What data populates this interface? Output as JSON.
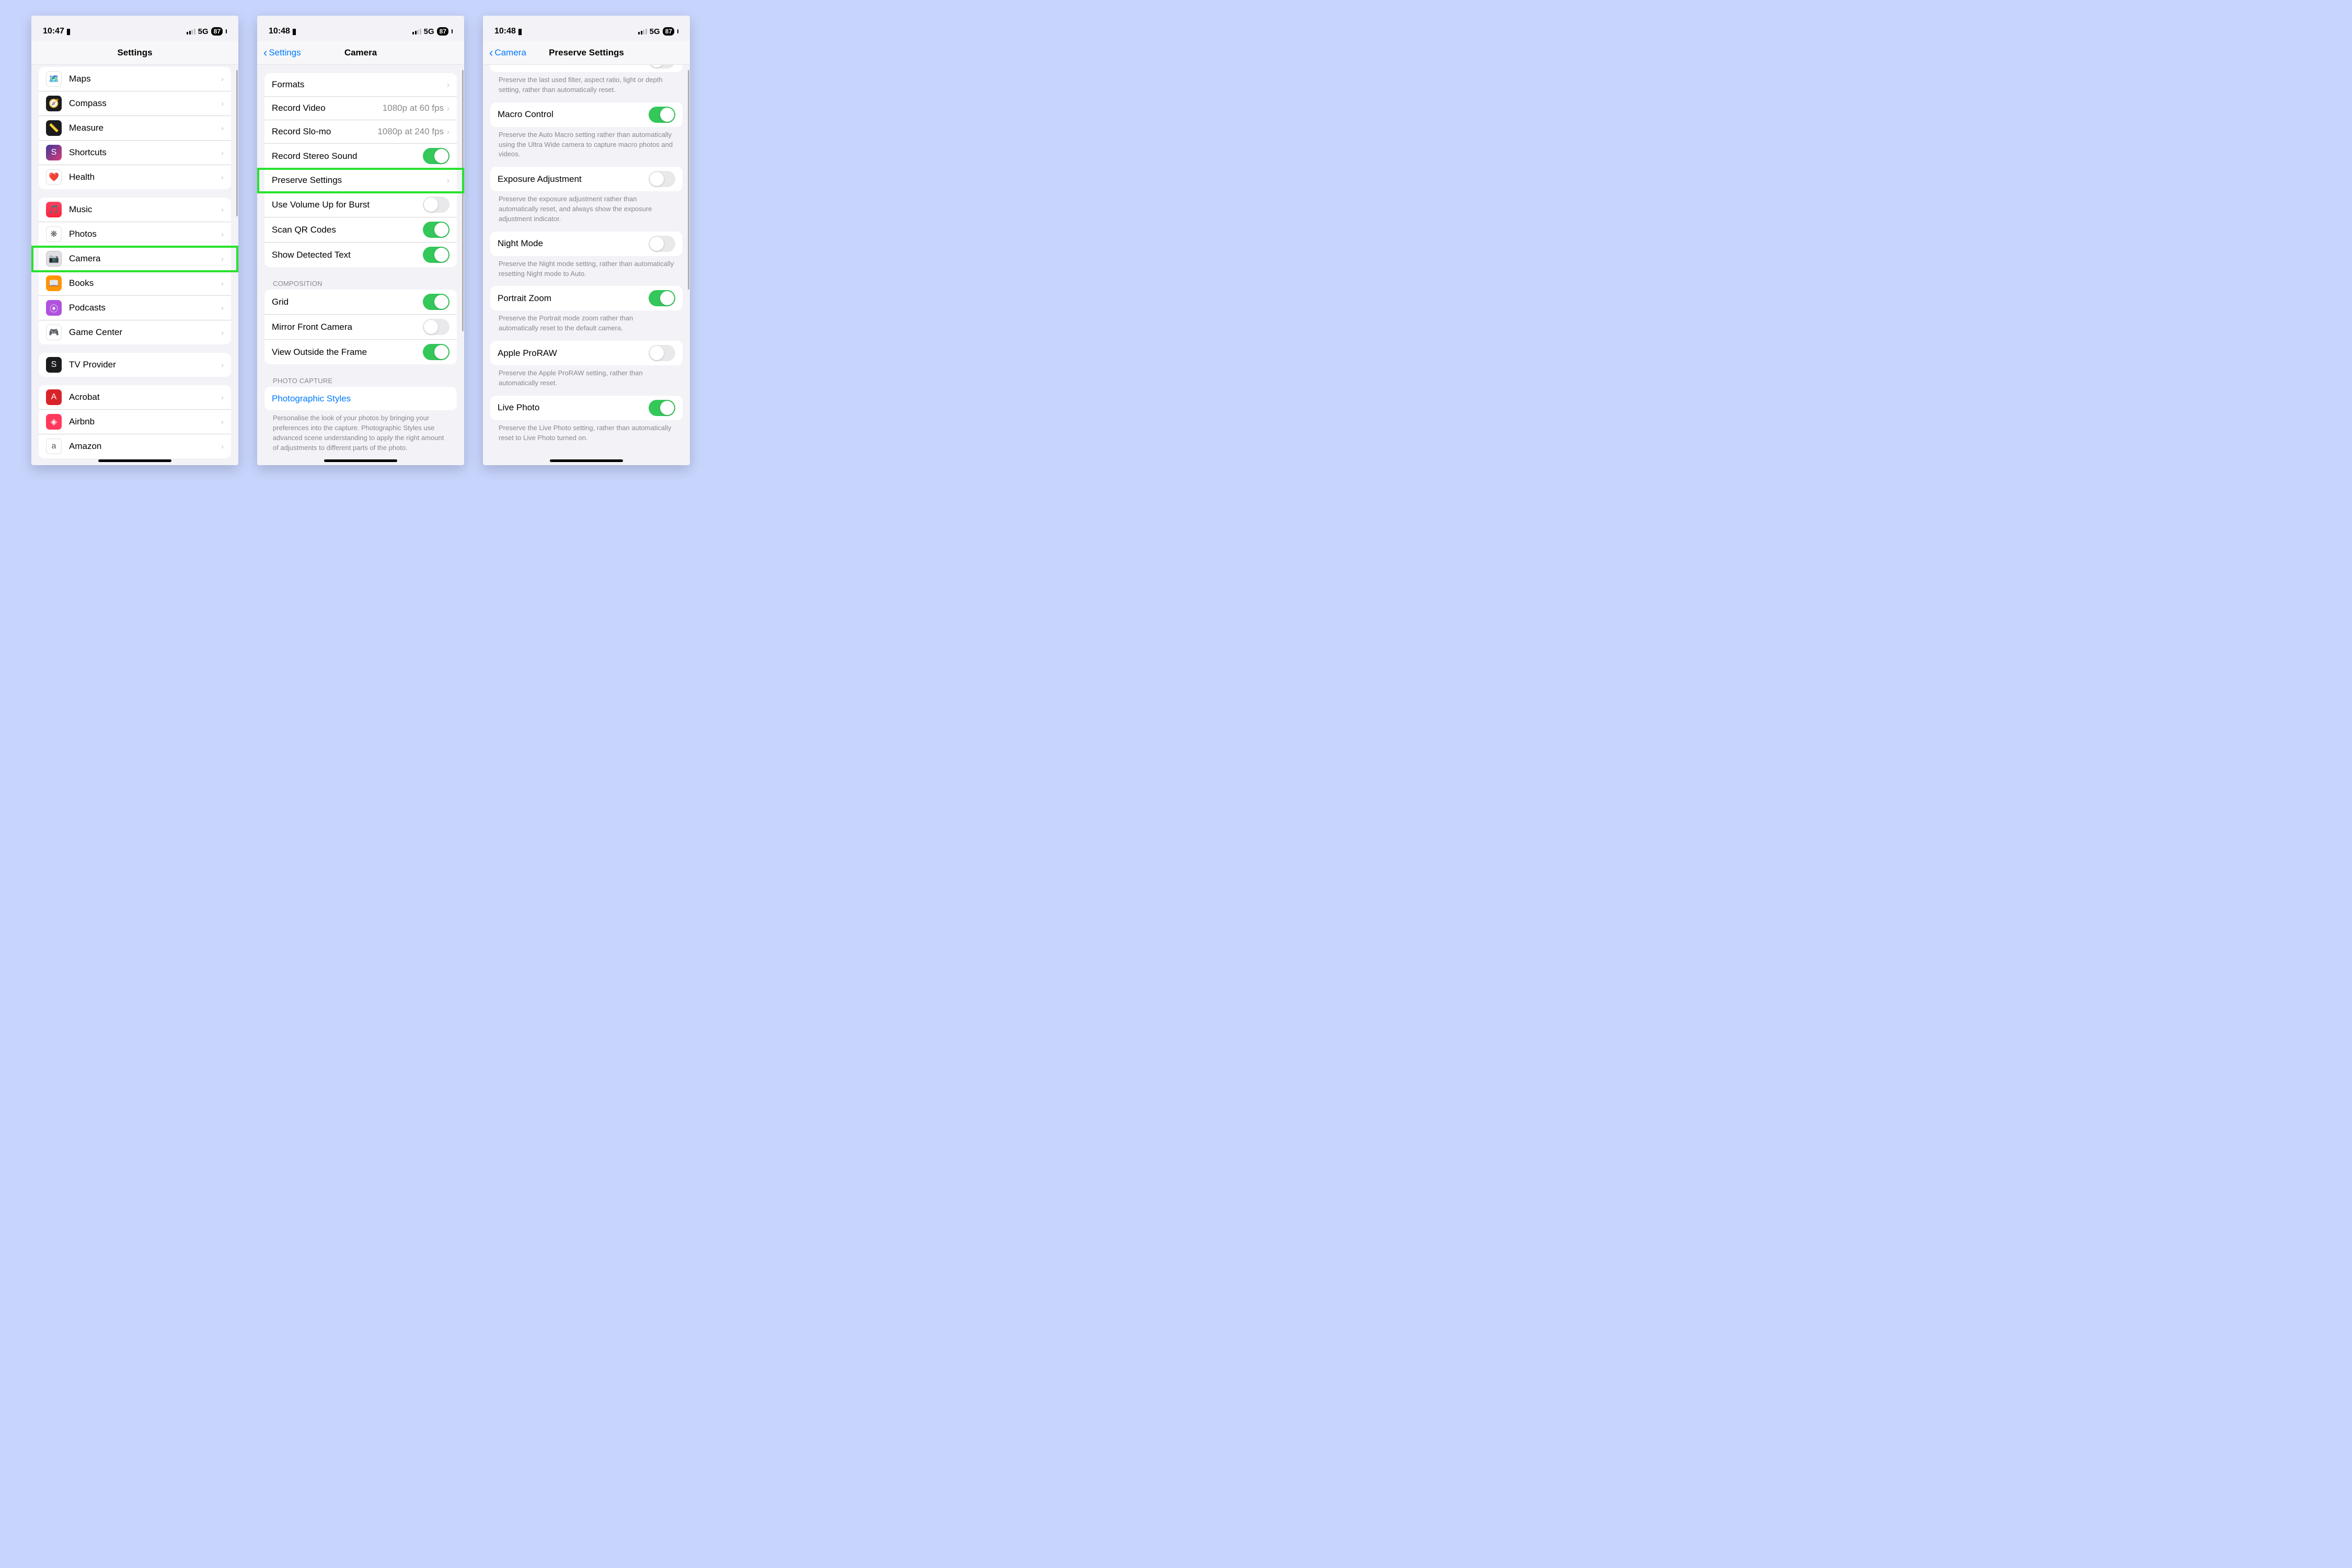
{
  "status": {
    "time1": "10:47",
    "time2": "10:48",
    "time3": "10:48",
    "network": "5G",
    "battery": "87"
  },
  "phone1": {
    "title": "Settings",
    "group1": [
      {
        "icon": "🗺️",
        "bg": "#ffffff",
        "class": "white",
        "label": "Maps"
      },
      {
        "icon": "🧭",
        "bg": "#1c1c1e",
        "label": "Compass"
      },
      {
        "icon": "📏",
        "bg": "#1c1c1e",
        "label": "Measure"
      },
      {
        "icon": "⬛",
        "bg": "linear-gradient(135deg,#3b3a9c,#da3a78)",
        "inner": "S",
        "label": "Shortcuts"
      },
      {
        "icon": "❤️",
        "bg": "#ffffff",
        "class": "white",
        "label": "Health"
      }
    ],
    "group2": [
      {
        "icon": "🎵",
        "bg": "linear-gradient(#fb4363,#fa233b)",
        "label": "Music"
      },
      {
        "icon": "❋",
        "bg": "#ffffff",
        "class": "white multicolor",
        "label": "Photos"
      },
      {
        "icon": "📷",
        "bg": "#e0e0e4",
        "class": "white",
        "label": "Camera",
        "highlight": true
      },
      {
        "icon": "📖",
        "bg": "#ff9500",
        "label": "Books"
      },
      {
        "icon": "📡",
        "bg": "#af52de",
        "inner": "⦿",
        "label": "Podcasts"
      },
      {
        "icon": "🎮",
        "bg": "#ffffff",
        "class": "white multicolor",
        "label": "Game Center"
      }
    ],
    "group3": [
      {
        "icon": "S",
        "bg": "#1c1c1e",
        "label": "TV Provider"
      }
    ],
    "group4": [
      {
        "icon": "A",
        "bg": "#d8232a",
        "label": "Acrobat"
      },
      {
        "icon": "◈",
        "bg": "#ff385c",
        "label": "Airbnb"
      },
      {
        "icon": "a",
        "bg": "#ffffff",
        "class": "white",
        "inner_svg": "amazon",
        "label": "Amazon"
      }
    ]
  },
  "phone2": {
    "back": "Settings",
    "title": "Camera",
    "group1": [
      {
        "label": "Formats",
        "type": "chev"
      },
      {
        "label": "Record Video",
        "detail": "1080p at 60 fps",
        "type": "chev"
      },
      {
        "label": "Record Slo-mo",
        "detail": "1080p at 240 fps",
        "type": "chev"
      },
      {
        "label": "Record Stereo Sound",
        "type": "toggle",
        "on": true
      },
      {
        "label": "Preserve Settings",
        "type": "chev",
        "highlight": true
      },
      {
        "label": "Use Volume Up for Burst",
        "type": "toggle",
        "on": false
      },
      {
        "label": "Scan QR Codes",
        "type": "toggle",
        "on": true
      },
      {
        "label": "Show Detected Text",
        "type": "toggle",
        "on": true
      }
    ],
    "section2_header": "Composition",
    "group2": [
      {
        "label": "Grid",
        "type": "toggle",
        "on": true
      },
      {
        "label": "Mirror Front Camera",
        "type": "toggle",
        "on": false
      },
      {
        "label": "View Outside the Frame",
        "type": "toggle",
        "on": true
      }
    ],
    "section3_header": "Photo Capture",
    "group3": [
      {
        "label": "Photographic Styles",
        "type": "link"
      }
    ],
    "footer3": "Personalise the look of your photos by bringing your preferences into the capture. Photographic Styles use advanced scene understanding to apply the right amount of adjustments to different parts of the photo."
  },
  "phone3": {
    "back": "Camera",
    "title": "Preserve Settings",
    "pre_footer": "Preserve the last used filter, aspect ratio, light or depth setting, rather than automatically reset.",
    "items": [
      {
        "label": "Macro Control",
        "on": true,
        "footer": "Preserve the Auto Macro setting rather than automatically using the Ultra Wide camera to capture macro photos and videos."
      },
      {
        "label": "Exposure Adjustment",
        "on": false,
        "footer": "Preserve the exposure adjustment rather than automatically reset, and always show the exposure adjustment indicator."
      },
      {
        "label": "Night Mode",
        "on": false,
        "footer": "Preserve the Night mode setting, rather than automatically resetting Night mode to Auto."
      },
      {
        "label": "Portrait Zoom",
        "on": true,
        "footer": "Preserve the Portrait mode zoom rather than automatically reset to the default camera."
      },
      {
        "label": "Apple ProRAW",
        "on": false,
        "footer": "Preserve the Apple ProRAW setting, rather than automatically reset."
      },
      {
        "label": "Live Photo",
        "on": true,
        "footer": "Preserve the Live Photo setting, rather than automatically reset to Live Photo turned on."
      }
    ]
  }
}
